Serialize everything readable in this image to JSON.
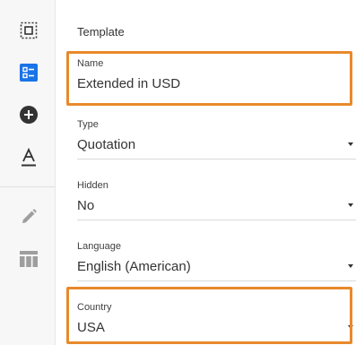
{
  "sidebar": {
    "items": [
      {
        "icon": "select-frame-icon",
        "active": false
      },
      {
        "icon": "list-layout-icon",
        "active": true
      },
      {
        "icon": "add-circle-icon",
        "active": false
      },
      {
        "icon": "text-format-icon",
        "active": false
      },
      {
        "icon": "pencil-icon",
        "active": false
      },
      {
        "icon": "table-icon",
        "active": false
      }
    ]
  },
  "panel": {
    "section_title": "Template",
    "fields": {
      "name": {
        "label": "Name",
        "value": "Extended in USD"
      },
      "type": {
        "label": "Type",
        "value": "Quotation"
      },
      "hidden": {
        "label": "Hidden",
        "value": "No"
      },
      "language": {
        "label": "Language",
        "value": "English (American)"
      },
      "country": {
        "label": "Country",
        "value": "USA"
      }
    }
  },
  "colors": {
    "accent": "#1a73e8",
    "highlight": "#e8892b",
    "icon_dark": "#333333",
    "icon_muted": "#9e9e9e"
  }
}
